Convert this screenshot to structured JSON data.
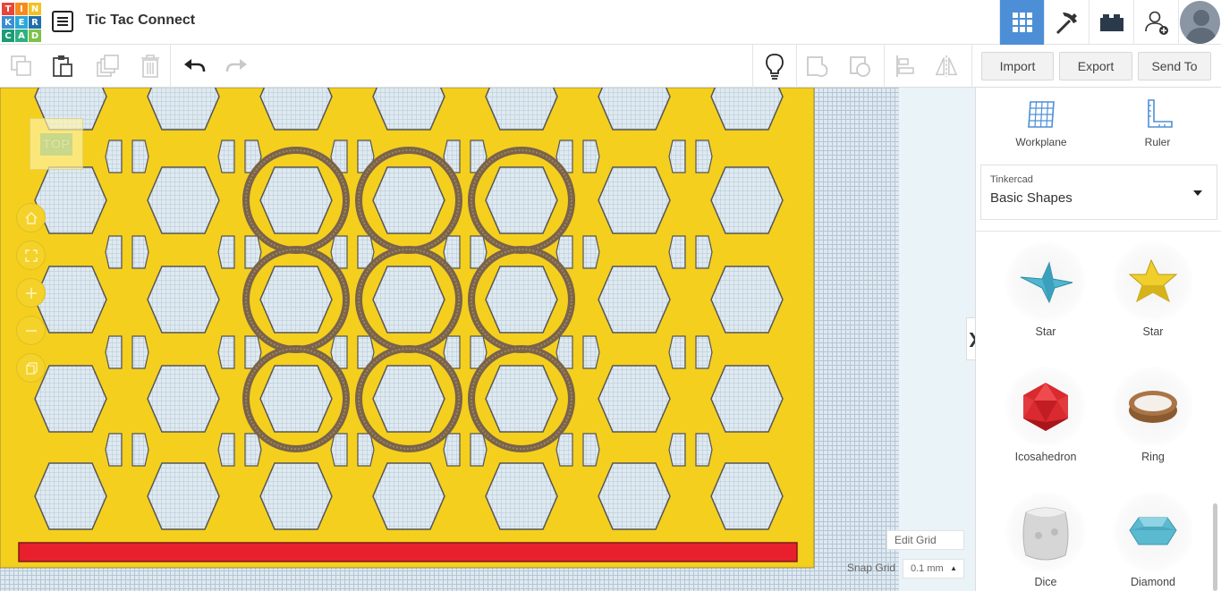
{
  "app": {
    "logo_letters": [
      "T",
      "I",
      "N",
      "K",
      "E",
      "R",
      "C",
      "A",
      "D"
    ],
    "logo_colors": [
      "#e8463b",
      "#f68c1e",
      "#f3c220",
      "#3b8fd1",
      "#2ba7d7",
      "#1f6fae",
      "#1a9c75",
      "#2fb080",
      "#7cc24b"
    ],
    "design_title": "Tic Tac Connect"
  },
  "topnav": {
    "items": [
      {
        "name": "3d-design-view",
        "icon": "grid-icon",
        "active": true
      },
      {
        "name": "minecraft-view",
        "icon": "pickaxe-icon",
        "active": false
      },
      {
        "name": "brick-view",
        "icon": "brick-icon",
        "active": false
      },
      {
        "name": "invite-user",
        "icon": "add-user-icon",
        "active": false
      }
    ],
    "active_color": "#4d8fd6"
  },
  "toolbar": {
    "import_label": "Import",
    "export_label": "Export",
    "send_to_label": "Send To"
  },
  "workspace": {
    "view_label": "TOP",
    "board_color": "#f4cf1e",
    "bar_color": "#e8202e",
    "ring_color": "#7a6348",
    "edit_grid_label": "Edit Grid",
    "snap_grid_label": "Snap Grid",
    "snap_grid_value": "0.1 mm"
  },
  "panel": {
    "workplane_label": "Workplane",
    "ruler_label": "Ruler",
    "library_source": "Tinkercad",
    "library_name": "Basic Shapes",
    "shapes": [
      {
        "label": "Star",
        "icon": "star-blue-icon"
      },
      {
        "label": "Star",
        "icon": "star-yellow-icon"
      },
      {
        "label": "Icosahedron",
        "icon": "icosahedron-icon"
      },
      {
        "label": "Ring",
        "icon": "ring-icon"
      },
      {
        "label": "Dice",
        "icon": "dice-icon"
      },
      {
        "label": "Diamond",
        "icon": "diamond-icon"
      }
    ]
  }
}
